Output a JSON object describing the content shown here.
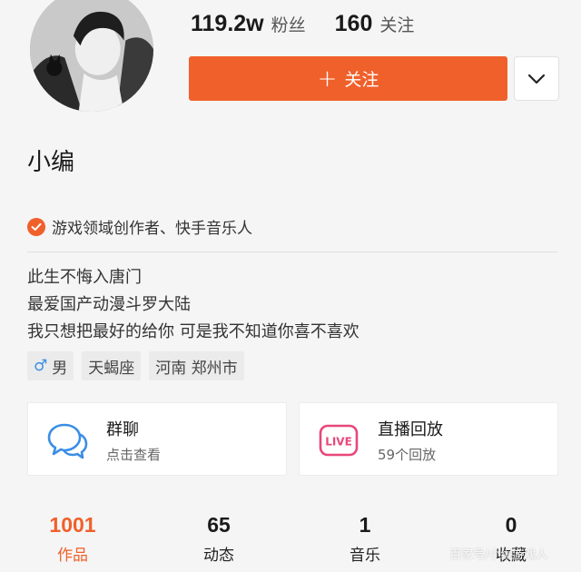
{
  "profile": {
    "name": "小编",
    "followers_count": "119.2w",
    "followers_label": "粉丝",
    "following_count": "160",
    "following_label": "关注"
  },
  "actions": {
    "follow_plus": "+",
    "follow_label": "关注"
  },
  "verification": {
    "text": "游戏领域创作者、快手音乐人"
  },
  "bio": {
    "lines": [
      "此生不悔入唐门",
      "最爱国产动漫斗罗大陆",
      "我只想把最好的给你 可是我不知道你喜不喜欢"
    ]
  },
  "tags": {
    "gender_symbol": "♂",
    "gender": "男",
    "zodiac": "天蝎座",
    "location": "河南 郑州市"
  },
  "cards": {
    "group_chat": {
      "title": "群聊",
      "subtitle": "点击查看"
    },
    "live_replay": {
      "title": "直播回放",
      "subtitle": "59个回放",
      "icon_text": "LIVE"
    }
  },
  "tabs": [
    {
      "count": "1001",
      "label": "作品"
    },
    {
      "count": "65",
      "label": "动态"
    },
    {
      "count": "1",
      "label": "音乐"
    },
    {
      "count": "0",
      "label": "收藏"
    }
  ],
  "colors": {
    "accent": "#f0602b",
    "live_pink": "#e8477a",
    "chat_blue": "#3b8ee6"
  },
  "icons": [
    "avatar-illustration",
    "chevron-down-icon",
    "check-badge-icon",
    "chat-bubbles-icon",
    "live-icon"
  ],
  "watermark": "百家号/小编游戏人"
}
